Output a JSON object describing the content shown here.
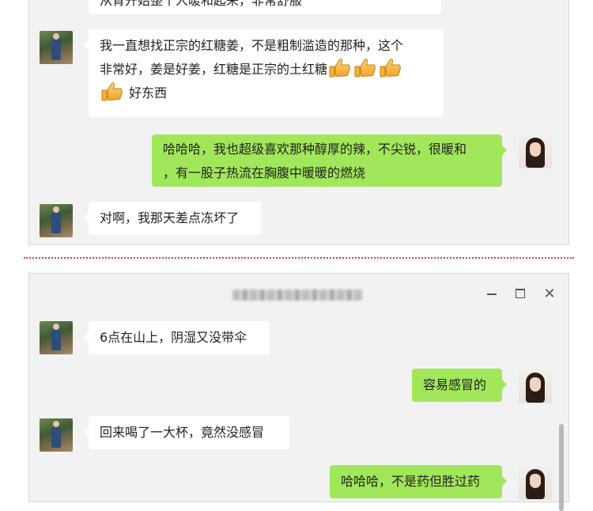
{
  "top_chat": {
    "messages": [
      {
        "side": "left",
        "lines": [
          "从胃开始整个人暖和起来，非常舒服"
        ]
      },
      {
        "side": "left",
        "lines": [
          "我一直想找正宗的红糖姜，不是粗制滥造的那种，这个",
          "非常好，姜是好姜，红糖是正宗的土红糖"
        ],
        "trailing_text": "好东西"
      },
      {
        "side": "right",
        "lines": [
          "哈哈哈，我也超级喜欢那种醇厚的辣，不尖锐，很暖和",
          "，有一股子热流在胸腹中暖暖的燃烧"
        ]
      },
      {
        "side": "left",
        "lines": [
          "对啊，我那天差点冻坏了"
        ]
      }
    ]
  },
  "bottom_chat": {
    "messages": [
      {
        "side": "left",
        "lines": [
          "6点在山上，阴湿又没带伞"
        ]
      },
      {
        "side": "right",
        "lines": [
          "容易感冒的"
        ]
      },
      {
        "side": "left",
        "lines": [
          "回来喝了一大杯，竟然没感冒"
        ]
      },
      {
        "side": "right",
        "lines": [
          "哈哈哈，不是药但胜过药"
        ]
      }
    ]
  },
  "icons": {
    "thumbs_up": "thumbs-up-emoji",
    "minimize": "minimize-icon",
    "maximize": "maximize-icon",
    "close": "close-icon"
  },
  "colors": {
    "incoming_bubble": "#ffffff",
    "outgoing_bubble": "#a0e75a",
    "panel_bg": "#f2f2f2",
    "divider": "#e23b3b"
  },
  "window_controls": {
    "close_glyph": "✕"
  }
}
